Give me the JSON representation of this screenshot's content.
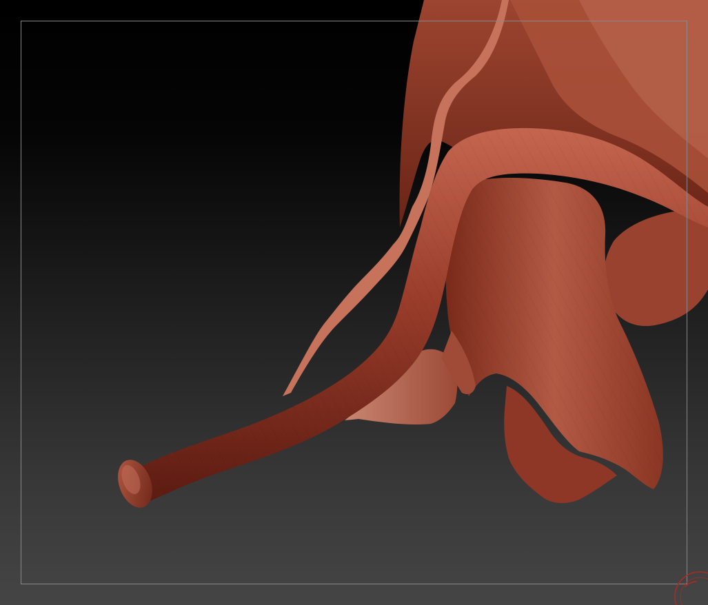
{
  "app": {
    "canvas_background_top": "#000000",
    "canvas_background_bottom": "#454545",
    "frame_color": "#8a8a8a"
  },
  "model": {
    "description_icon": "sculpted-flower-mesh",
    "material_base_color": "#8e3a2a",
    "material_highlight_color": "#c2604a",
    "material_shadow_color": "#4a160e"
  },
  "gizmo": {
    "icon": "navigation-gyro-icon",
    "color": "#b02a20"
  }
}
